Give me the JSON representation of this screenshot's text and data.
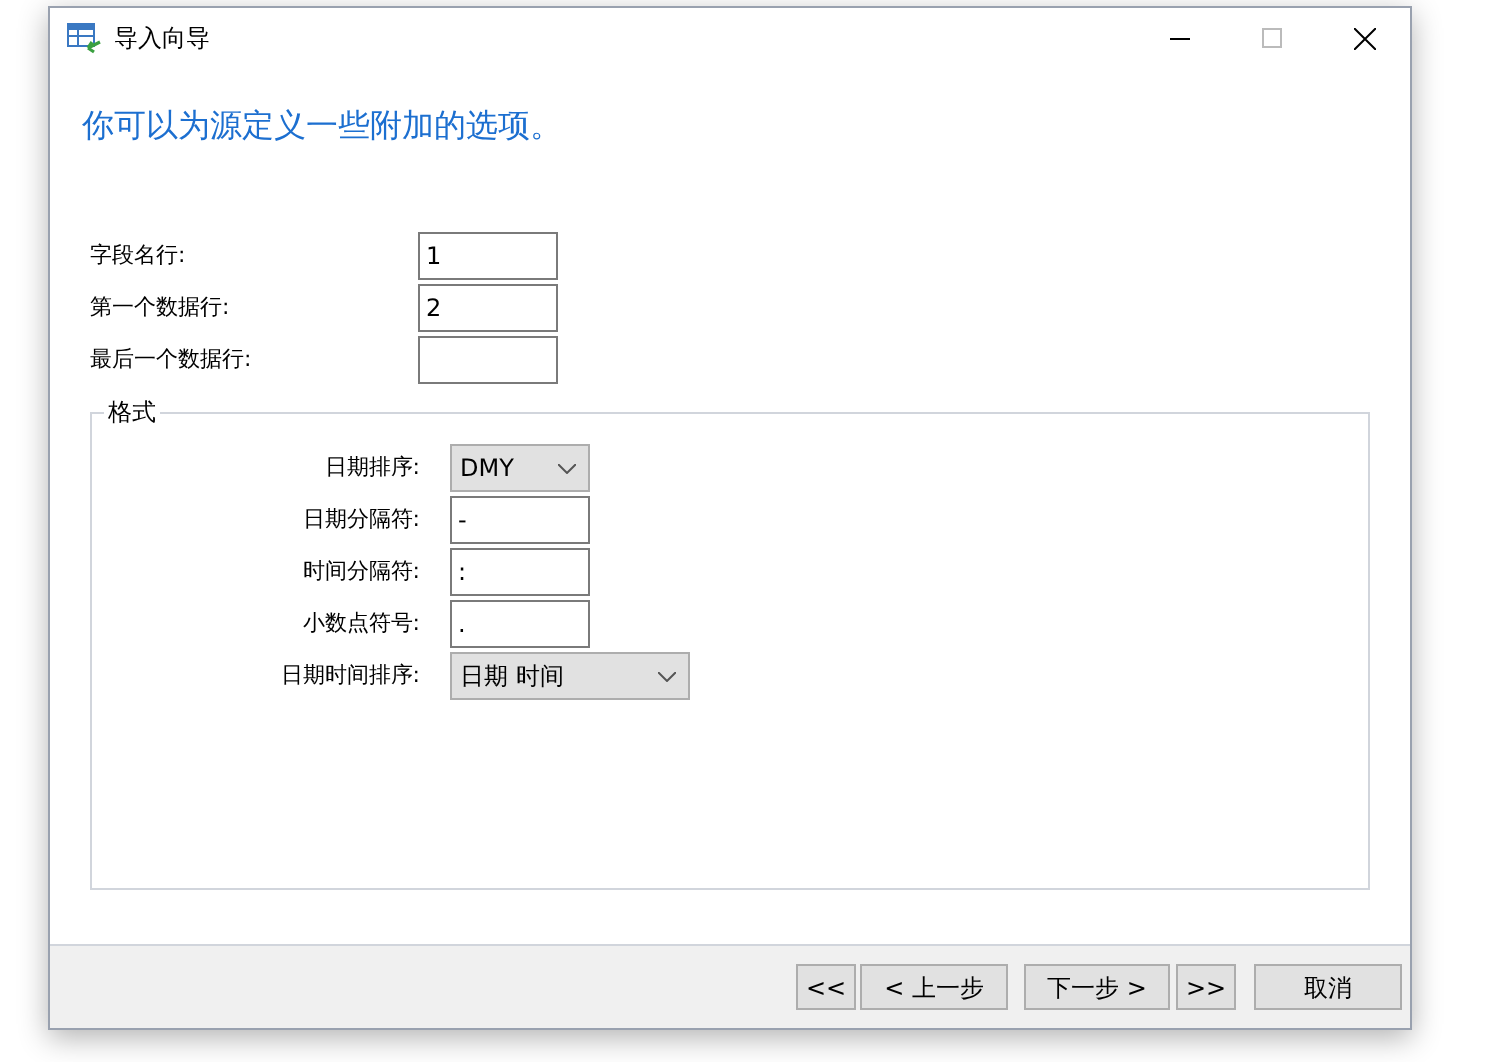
{
  "window": {
    "title": "导入向导"
  },
  "heading": "你可以为源定义一些附加的选项。",
  "rows": [
    {
      "label": "字段名行:",
      "kind": "text",
      "value": "1"
    },
    {
      "label": "第一个数据行:",
      "kind": "text",
      "value": "2"
    },
    {
      "label": "最后一个数据行:",
      "kind": "text",
      "value": ""
    }
  ],
  "format_group": {
    "title": "格式",
    "rows": [
      {
        "label": "日期排序:",
        "kind": "dropdown",
        "value": "DMY"
      },
      {
        "label": "日期分隔符:",
        "kind": "text",
        "value": "-"
      },
      {
        "label": "时间分隔符:",
        "kind": "text",
        "value": ":"
      },
      {
        "label": "小数点符号:",
        "kind": "text",
        "value": "."
      },
      {
        "label": "日期时间排序:",
        "kind": "dropdown",
        "value": "日期 时间"
      }
    ]
  },
  "buttons": [
    "<<",
    "< 上一步",
    "下一步 >",
    ">>",
    "取消"
  ]
}
